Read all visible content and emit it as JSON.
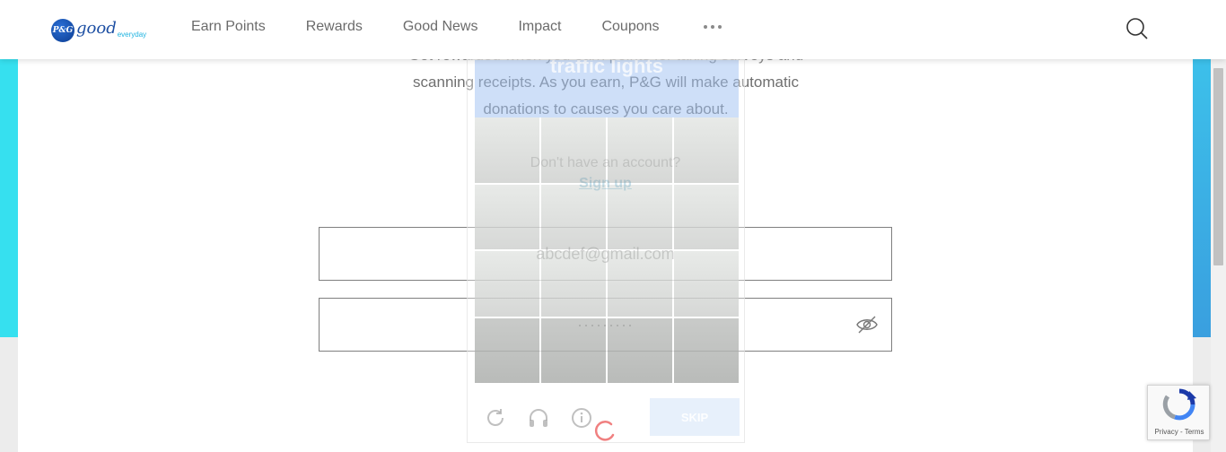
{
  "header": {
    "logo": {
      "badge": "P&G",
      "word": "good",
      "sub": "everyday"
    },
    "nav": [
      {
        "label": "Earn Points"
      },
      {
        "label": "Rewards"
      },
      {
        "label": "Good News"
      },
      {
        "label": "Impact"
      },
      {
        "label": "Coupons"
      }
    ],
    "more_icon": "ellipsis-icon",
    "search_icon": "search-icon"
  },
  "hero": {
    "line1_partial": "Get rewarded when you earn points for taking surveys and",
    "line2": "scanning receipts. As you earn, P&G will make automatic",
    "line3": "donations to causes you care about."
  },
  "signup": {
    "prompt": "Don't have an account?",
    "link": "Sign up"
  },
  "form": {
    "email_value": "abcdef@gmail.com",
    "password_value": "·········",
    "toggle_icon": "eye-off-icon"
  },
  "captcha": {
    "prompt": "traffic lights",
    "skip_label": "SKIP",
    "icons": [
      "refresh-icon",
      "headphones-icon",
      "info-icon"
    ]
  },
  "recaptcha": {
    "terms": "Privacy - Terms"
  },
  "colors": {
    "accent_cyan": "#36e0ef",
    "link_blue": "#2a8ab8",
    "spinner": "#f08080"
  }
}
